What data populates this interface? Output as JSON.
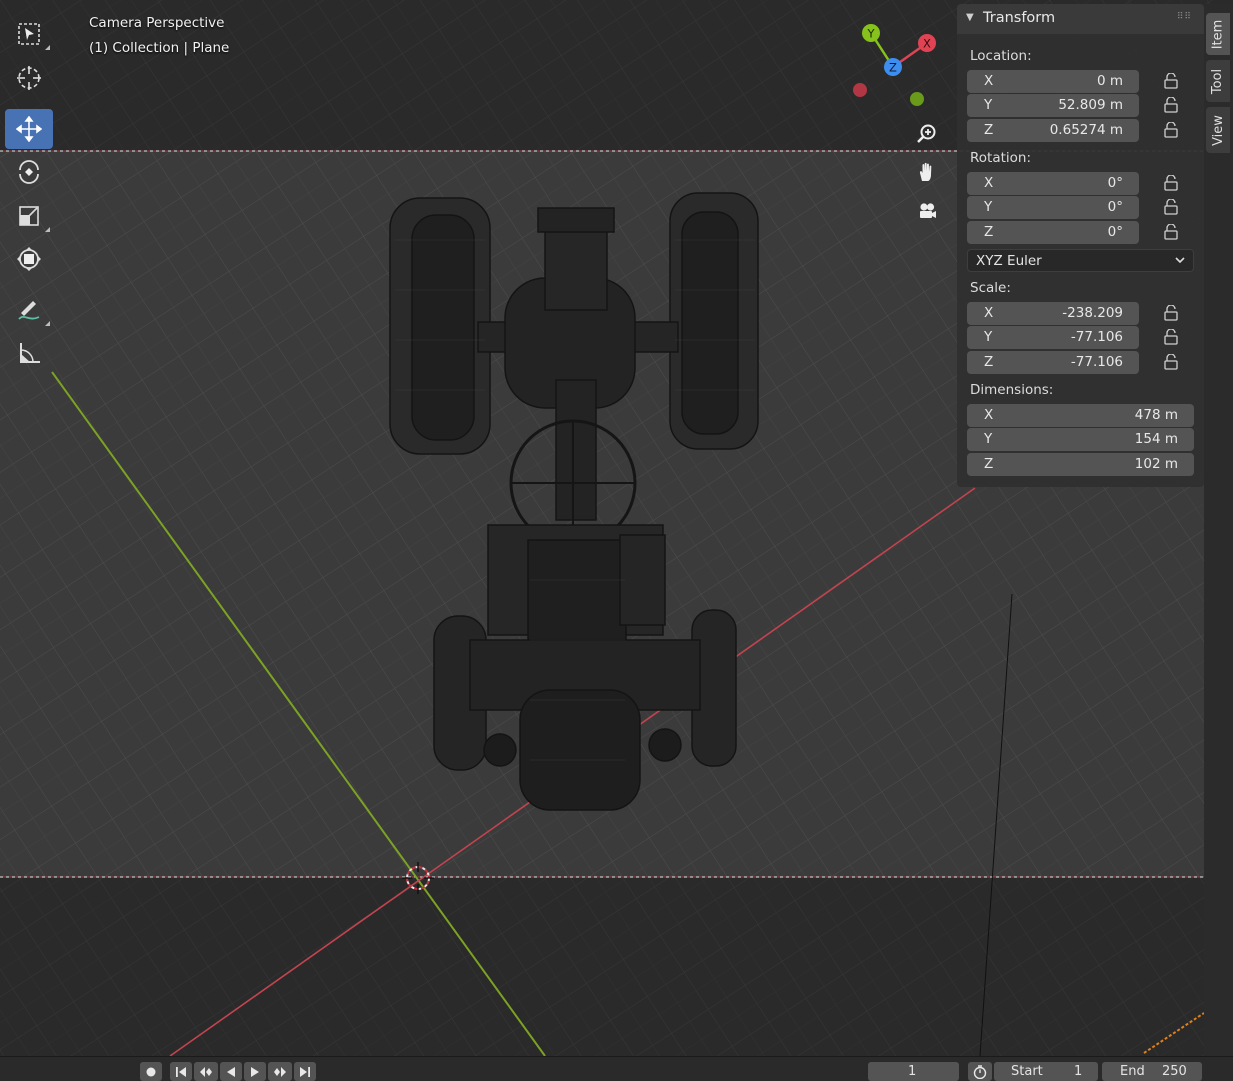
{
  "viewport": {
    "camera_title": "Camera Perspective",
    "collection_label": "(1) Collection | Plane"
  },
  "toolbar": {
    "items": [
      {
        "name": "select-box-tool",
        "icon": "select-box-icon",
        "active": false
      },
      {
        "name": "cursor-tool",
        "icon": "cursor-icon",
        "active": false
      },
      {
        "name": "move-tool",
        "icon": "move-icon",
        "active": true
      },
      {
        "name": "rotate-tool",
        "icon": "rotate-icon",
        "active": false
      },
      {
        "name": "scale-tool",
        "icon": "scale-icon",
        "active": false
      },
      {
        "name": "transform-tool",
        "icon": "transform-icon",
        "active": false
      },
      {
        "name": "annotate-tool",
        "icon": "annotate-icon",
        "active": false
      },
      {
        "name": "measure-tool",
        "icon": "measure-icon",
        "active": false
      }
    ]
  },
  "gizmo": {
    "x_label": "X",
    "y_label": "Y",
    "z_label": "Z",
    "colors": {
      "x": "#e04454",
      "y": "#86c11c",
      "z": "#3e8ef0"
    }
  },
  "transform_panel": {
    "title": "Transform",
    "location": {
      "label": "Location:",
      "x": {
        "axis": "X",
        "value": "0 m"
      },
      "y": {
        "axis": "Y",
        "value": "52.809 m"
      },
      "z": {
        "axis": "Z",
        "value": "0.65274 m"
      }
    },
    "rotation": {
      "label": "Rotation:",
      "x": {
        "axis": "X",
        "value": "0°"
      },
      "y": {
        "axis": "Y",
        "value": "0°"
      },
      "z": {
        "axis": "Z",
        "value": "0°"
      },
      "mode": "XYZ Euler"
    },
    "scale": {
      "label": "Scale:",
      "x": {
        "axis": "X",
        "value": "-238.209"
      },
      "y": {
        "axis": "Y",
        "value": "-77.106"
      },
      "z": {
        "axis": "Z",
        "value": "-77.106"
      }
    },
    "dimensions": {
      "label": "Dimensions:",
      "x": {
        "axis": "X",
        "value": "478 m"
      },
      "y": {
        "axis": "Y",
        "value": "154 m"
      },
      "z": {
        "axis": "Z",
        "value": "102 m"
      }
    }
  },
  "side_tabs": {
    "item": "Item",
    "tool": "Tool",
    "view": "View"
  },
  "timeline": {
    "current_frame": "1",
    "start_label": "Start",
    "start_value": "1",
    "end_label": "End",
    "end_value": "250"
  }
}
